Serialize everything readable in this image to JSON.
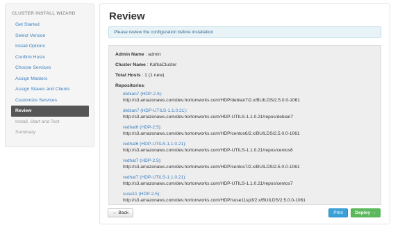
{
  "wizard": {
    "title": "CLUSTER INSTALL WIZARD",
    "steps": [
      {
        "label": "Get Started",
        "state": "link"
      },
      {
        "label": "Select Version",
        "state": "link"
      },
      {
        "label": "Install Options",
        "state": "link"
      },
      {
        "label": "Confirm Hosts",
        "state": "link"
      },
      {
        "label": "Choose Services",
        "state": "link"
      },
      {
        "label": "Assign Masters",
        "state": "link"
      },
      {
        "label": "Assign Slaves and Clients",
        "state": "link"
      },
      {
        "label": "Customize Services",
        "state": "link"
      },
      {
        "label": "Review",
        "state": "active"
      },
      {
        "label": "Install, Start and Test",
        "state": "disabled"
      },
      {
        "label": "Summary",
        "state": "disabled"
      }
    ]
  },
  "main": {
    "title": "Review",
    "alert": "Please review the configuration before installation",
    "admin_label": "Admin Name",
    "admin_value": ": admin",
    "cluster_label": "Cluster Name",
    "cluster_value": ": KafkaCluster",
    "hosts_label": "Total Hosts",
    "hosts_value": ": 1 (1 new)",
    "repos_label": "Repositories",
    "repos_colon": ":",
    "repositories": [
      {
        "name": "debian7 (HDP-2.5):",
        "url": "http://s3.amazonaws.com/dev.hortonworks.com/HDP/debian7/2.x/BUILDS/2.5.0.0-1061"
      },
      {
        "name": "debian7 (HDP-UTILS-1.1.0.21):",
        "url": "http://s3.amazonaws.com/dev.hortonworks.com/HDP-UTILS-1.1.0.21/repos/debian7"
      },
      {
        "name": "redhat6 (HDP-2.5):",
        "url": "http://s3.amazonaws.com/dev.hortonworks.com/HDP/centos6/2.x/BUILDS/2.5.0.0-1061"
      },
      {
        "name": "redhat6 (HDP-UTILS-1.1.0.21):",
        "url": "http://s3.amazonaws.com/dev.hortonworks.com/HDP-UTILS-1.1.0.21/repos/centos6"
      },
      {
        "name": "redhat7 (HDP-2.5):",
        "url": "http://s3.amazonaws.com/dev.hortonworks.com/HDP/centos7/2.x/BUILDS/2.5.0.0-1061"
      },
      {
        "name": "redhat7 (HDP-UTILS-1.1.0.21):",
        "url": "http://s3.amazonaws.com/dev.hortonworks.com/HDP-UTILS-1.1.0.21/repos/centos7"
      },
      {
        "name": "suse11 (HDP-2.5):",
        "url": "http://s3.amazonaws.com/dev.hortonworks.com/HDP/suse11sp3/2.x/BUILDS/2.5.0.0-1061"
      }
    ]
  },
  "buttons": {
    "back": "← Back",
    "print": "Print",
    "deploy": "Deploy →"
  },
  "colors": {
    "link": "#3a7fc0",
    "active_step_bg": "#555555",
    "print_bg": "#3aa0d8",
    "deploy_bg": "#5cb85c"
  }
}
